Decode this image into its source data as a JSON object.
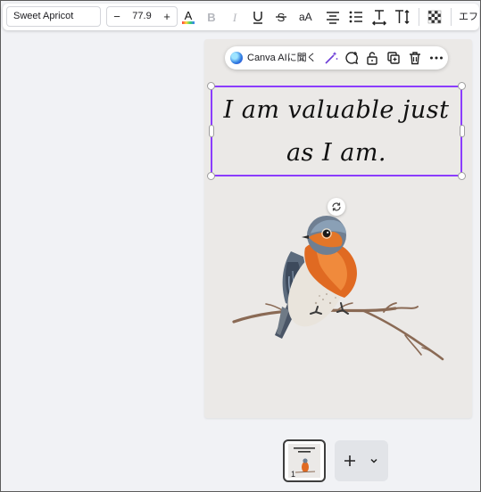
{
  "toolbar": {
    "font_name": "Sweet Apricot",
    "font_size": "77.9",
    "decrease_label": "−",
    "increase_label": "+",
    "case_label": "aA",
    "effects_label": "エフ",
    "icons": [
      "text-color-icon",
      "bold-icon",
      "italic-icon",
      "underline-icon",
      "strikethrough-icon",
      "letter-case-icon",
      "align-center-icon",
      "list-icon",
      "letter-spacing-icon",
      "text-direction-icon",
      "transparency-icon"
    ]
  },
  "context_bar": {
    "ai_label": "Canva AIに聞く",
    "icons": [
      "magic-write-icon",
      "comment-icon",
      "lock-icon",
      "duplicate-icon",
      "delete-icon",
      "more-icon"
    ]
  },
  "design": {
    "quote_line1": "I am valuable just",
    "quote_line2": "as I am.",
    "image": "robin-on-branch"
  },
  "pages": {
    "current_page_number": "1",
    "add_page_icon": "plus-icon",
    "more_icon": "chevron-down-icon"
  },
  "colors": {
    "selection": "#8b3dff",
    "page_background": "#ebe9e7",
    "canvas_background": "#f1f2f5"
  }
}
